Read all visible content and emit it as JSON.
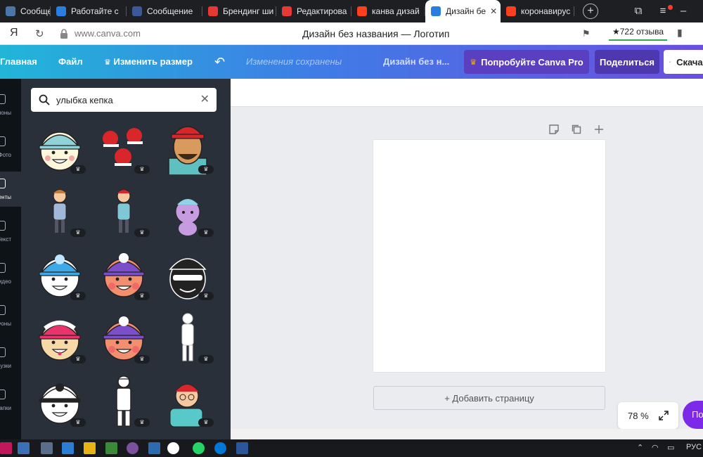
{
  "browser": {
    "tabs": [
      {
        "label": "Сообщения",
        "icon": "vk-icon",
        "color": "#4a76a8"
      },
      {
        "label": "Работайте с",
        "icon": "canva-icon",
        "color": "#2a7de1"
      },
      {
        "label": "Сообщение",
        "icon": "facebook-icon",
        "color": "#3b5998"
      },
      {
        "label": "Брендинг ши",
        "icon": "site-icon",
        "color": "#e53935"
      },
      {
        "label": "Редактирова",
        "icon": "site-icon",
        "color": "#e53935"
      },
      {
        "label": "канва дизай",
        "icon": "yandex-icon",
        "color": "#fc3f1d"
      },
      {
        "label": "Дизайн бе",
        "icon": "canva-icon",
        "color": "#2a7de1",
        "active": true
      },
      {
        "label": "коронавирус",
        "icon": "yandex-icon",
        "color": "#fc3f1d"
      }
    ],
    "address_logo": "Я",
    "url": "www.canva.com",
    "page_title": "Дизайн без названия — Логотип",
    "reviews": "★722 отзыва"
  },
  "header": {
    "home": "Главная",
    "file": "Файл",
    "resize": "Изменить размер",
    "saved_status": "Изменения сохранены",
    "design_name": "Дизайн без н...",
    "try_pro": "Попробуйте Canva Pro",
    "share": "Поделиться",
    "download": "Скачать",
    "accent_color": "#6a4fe0"
  },
  "sidebar": {
    "items": [
      {
        "label": "Шаблоны",
        "icon": "templates-icon"
      },
      {
        "label": "Фото",
        "icon": "photos-icon"
      },
      {
        "label": "Элементы",
        "icon": "elements-icon",
        "active": true
      },
      {
        "label": "Текст",
        "icon": "text-icon"
      },
      {
        "label": "Видео",
        "icon": "video-icon"
      },
      {
        "label": "Фоны",
        "icon": "background-icon"
      },
      {
        "label": "Загрузки",
        "icon": "uploads-icon"
      },
      {
        "label": "Папки",
        "icon": "folders-icon"
      }
    ]
  },
  "panel": {
    "search_value": "улыбка кепка",
    "results": [
      {
        "name": "boy-cap-face"
      },
      {
        "name": "red-caps-group"
      },
      {
        "name": "man-red-cap-portrait"
      },
      {
        "name": "boy-standing"
      },
      {
        "name": "boy-waving"
      },
      {
        "name": "purple-cat-cap"
      },
      {
        "name": "boy-blue-cap"
      },
      {
        "name": "boy-purple-cap"
      },
      {
        "name": "man-black-cap"
      },
      {
        "name": "boy-pink-cap"
      },
      {
        "name": "boy-purple-cap-blush"
      },
      {
        "name": "man-standing-outline"
      },
      {
        "name": "boy-black-cap"
      },
      {
        "name": "policeman-outline"
      },
      {
        "name": "man-red-cap-waving"
      }
    ],
    "pro_badge": "♛"
  },
  "canvas": {
    "add_page": "+ Добавить страницу",
    "zoom": "78 %",
    "help": "По"
  },
  "taskbar": {
    "language": "РУС"
  }
}
